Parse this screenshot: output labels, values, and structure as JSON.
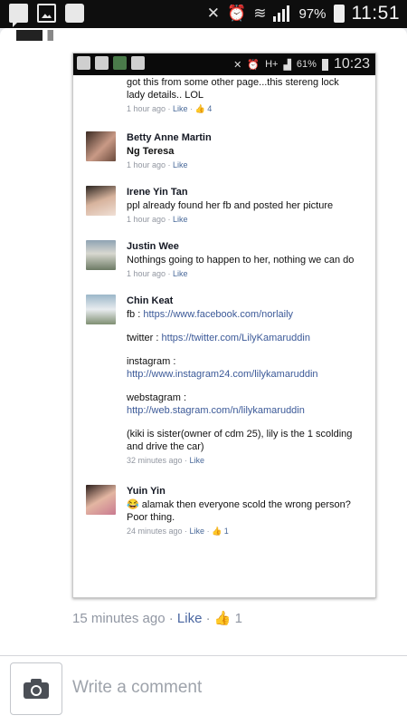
{
  "status_bar": {
    "battery": "97%",
    "time": "11:51"
  },
  "inner_status_bar": {
    "network": "H+",
    "battery": "61%",
    "time": "10:23"
  },
  "thread": [
    {
      "name": "",
      "text": "got this from some other page...this stereng lock lady details.. LOL",
      "time": "1 hour ago",
      "like_label": "Like",
      "likes": "4"
    },
    {
      "name": "Betty Anne Martin",
      "text": "Ng Teresa",
      "time": "1 hour ago",
      "like_label": "Like"
    },
    {
      "name": "Irene Yin Tan",
      "text": "ppl already found her fb and posted her picture",
      "time": "1 hour ago",
      "like_label": "Like"
    },
    {
      "name": "Justin Wee",
      "text": "Nothings going to happen to her, nothing we can do",
      "time": "1 hour ago",
      "like_label": "Like"
    },
    {
      "name": "Chin Keat",
      "fb_label": "fb : ",
      "fb_url": "https://www.facebook.com/norlaily",
      "twitter_label": "twitter : ",
      "twitter_url": "https://twitter.com/LilyKamaruddin",
      "instagram_label": "instagram : ",
      "instagram_url": "http://www.instagram24.com/lilykamaruddin",
      "webstagram_label": "webstagram : ",
      "webstagram_url": "http://web.stagram.com/n/lilykamaruddin",
      "text": "(kiki is sister(owner of cdm 25), lily is the 1 scolding and drive the car)",
      "time": "32 minutes ago",
      "like_label": "Like"
    },
    {
      "name": "Yuin Yin",
      "emoji": "😂",
      "text": "alamak then everyone scold the wrong person? Poor thing.",
      "time": "24 minutes ago",
      "like_label": "Like",
      "likes": "1"
    }
  ],
  "post_meta": {
    "time": "15 minutes ago",
    "like_label": "Like",
    "likes": "1"
  },
  "composer": {
    "placeholder": "Write a comment"
  },
  "icons": {
    "camera": "camera-icon",
    "thumb": "thumbs-up-icon"
  },
  "colors": {
    "link": "#3b5998",
    "meta": "#9197a3",
    "status_bg": "#0e0e0e"
  }
}
